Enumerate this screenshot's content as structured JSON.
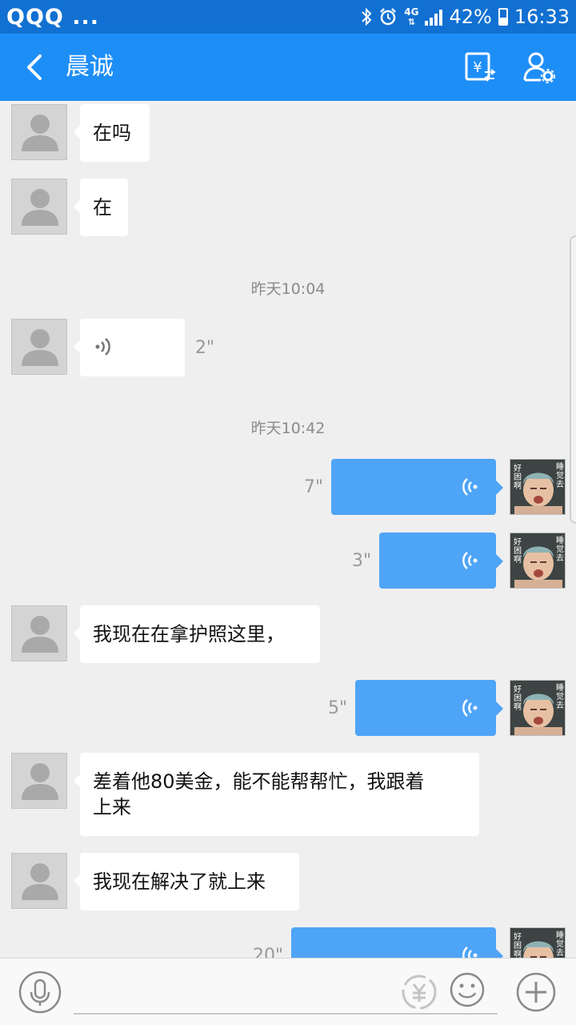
{
  "status_bar": {
    "notifications": "QQQ ...",
    "network": "4G",
    "battery": "42%",
    "time": "16:33"
  },
  "header": {
    "title": "晨诚",
    "back_icon": "chevron-left-icon",
    "transfer_icon": "yuan-transfer-icon",
    "profile_icon": "user-settings-icon"
  },
  "chat": {
    "messages": [
      {
        "side": "left",
        "type": "text",
        "text": "在吗"
      },
      {
        "side": "left",
        "type": "text",
        "text": "在"
      },
      {
        "type": "time",
        "text": "昨天10:04"
      },
      {
        "side": "left",
        "type": "voice",
        "duration": "2\""
      },
      {
        "type": "time",
        "text": "昨天10:42"
      },
      {
        "side": "right",
        "type": "voice",
        "duration": "7\""
      },
      {
        "side": "right",
        "type": "voice",
        "duration": "3\""
      },
      {
        "side": "left",
        "type": "text",
        "text": "我现在在拿护照这里，"
      },
      {
        "side": "right",
        "type": "voice",
        "duration": "5\""
      },
      {
        "side": "left",
        "type": "text",
        "line1": "差着他80美金，能不能帮帮忙，我跟着",
        "line2": "上来"
      },
      {
        "side": "left",
        "type": "text",
        "text": "我现在解决了就上来"
      },
      {
        "side": "right",
        "type": "voice",
        "duration": "20\""
      }
    ],
    "sticker_text": {
      "left": "好困啊",
      "right": "睡觉去"
    }
  },
  "input_bar": {
    "mic_icon": "microphone-icon",
    "currency_icon": "yuan-swap-icon",
    "emoji_icon": "smiley-icon",
    "plus_icon": "plus-circle-icon"
  },
  "colors": {
    "status_bar": "#1170d2",
    "header": "#1e8ef7",
    "self_bubble": "#4ea4f7",
    "other_bubble": "#ffffff",
    "background": "#efefef"
  }
}
